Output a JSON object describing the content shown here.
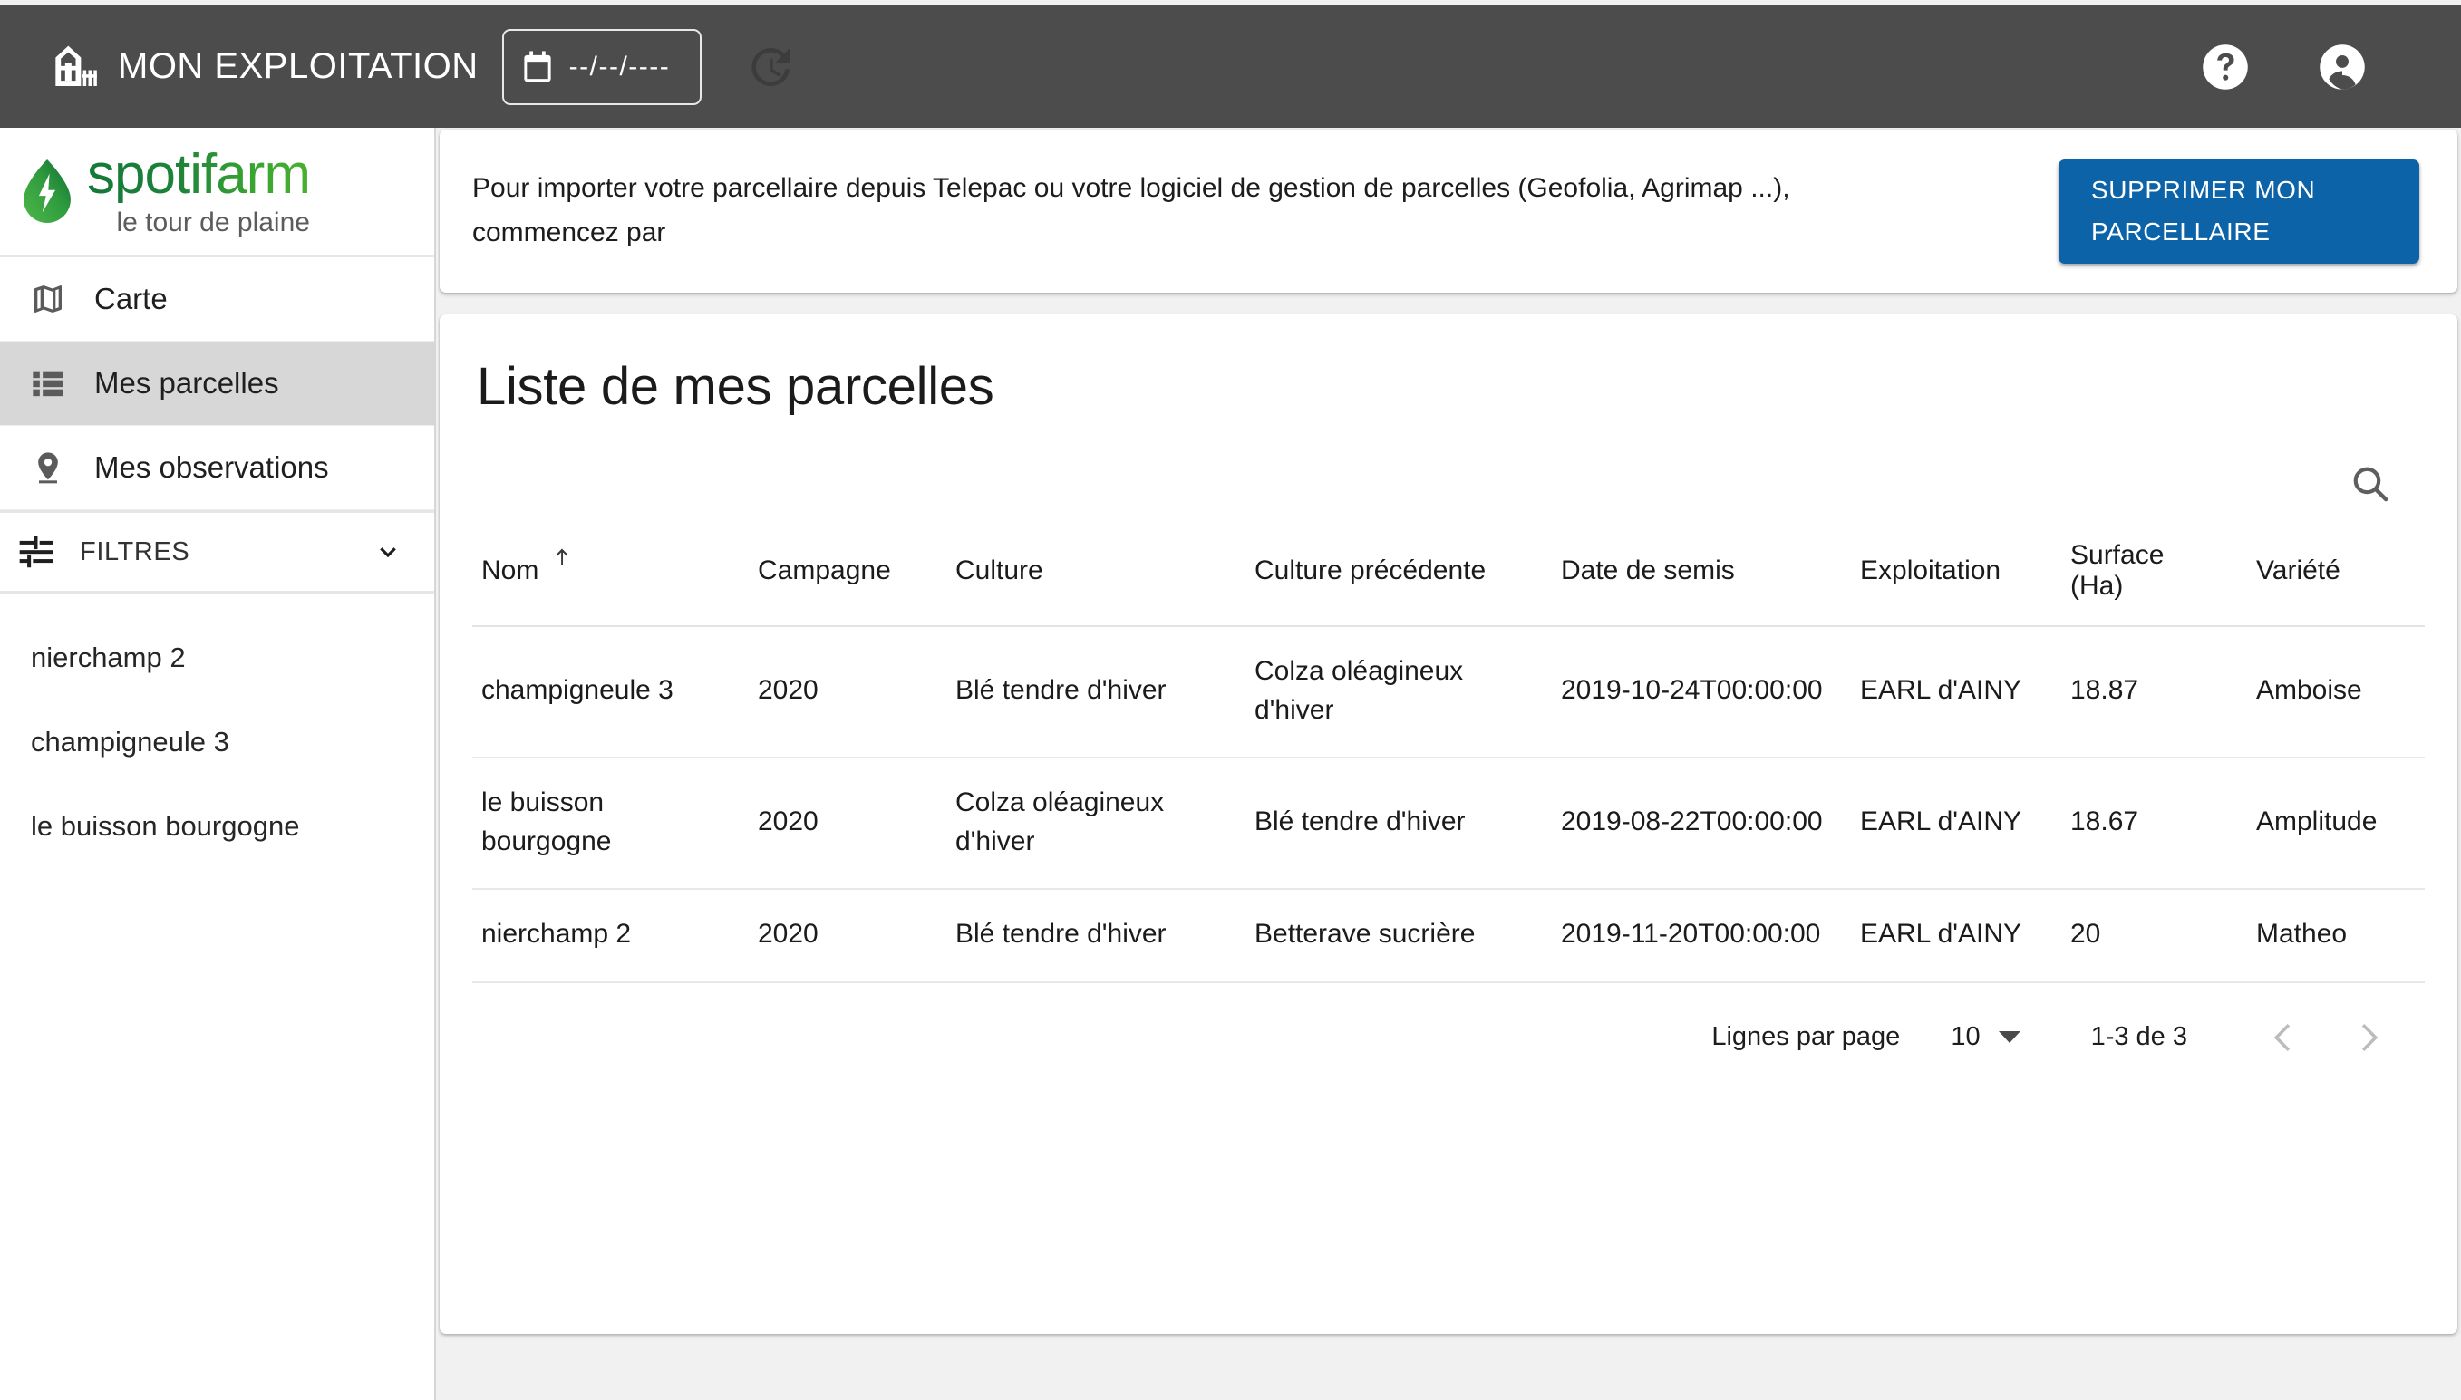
{
  "appbar": {
    "title": "MON EXPLOITATION",
    "date_value": "--/--/----",
    "icons": {
      "barn": "barn-icon",
      "calendar": "calendar-icon",
      "history": "history-icon",
      "help": "help-circle-icon",
      "account": "account-circle-icon"
    }
  },
  "sidebar": {
    "logo": {
      "word": "spotifarm",
      "tagline": "le tour de plaine"
    },
    "nav": [
      {
        "label": "Carte",
        "icon": "map-icon",
        "active": false
      },
      {
        "label": "Mes parcelles",
        "icon": "list-icon",
        "active": true
      },
      {
        "label": "Mes observations",
        "icon": "location-pin-icon",
        "active": false
      }
    ],
    "filters": {
      "label": "FILTRES",
      "icon": "tune-icon",
      "chevron": "chevron-down-icon"
    },
    "parcels": [
      "nierchamp 2",
      "champigneule 3",
      "le buisson bourgogne"
    ]
  },
  "banner": {
    "line1": "Pour importer votre parcellaire depuis Telepac ou votre logiciel de gestion de parcelles (Geofolia, Agrimap ...),",
    "line2": "commencez par",
    "button_line1": "SUPPRIMER MON",
    "button_line2": "PARCELLAIRE",
    "button_color": "#0c63a8"
  },
  "table_panel": {
    "title": "Liste de mes parcelles",
    "search_icon": "search-icon",
    "columns": [
      "Nom",
      "Campagne",
      "Culture",
      "Culture précédente",
      "Date de semis",
      "Exploitation",
      "Surface (Ha)",
      "Variété"
    ],
    "surface_header_line1": "Surface",
    "surface_header_line2": "(Ha)",
    "sort": {
      "column": "Nom",
      "direction": "asc",
      "icon": "arrow-upward-icon"
    },
    "rows": [
      {
        "nom": "champigneule 3",
        "campagne": "2020",
        "culture": "Blé tendre d'hiver",
        "precedente": "Colza oléagineux d'hiver",
        "date_semis": "2019-10-24T00:00:00",
        "exploitation": "EARL d'AINY",
        "surface": "18.87",
        "variete": "Amboise"
      },
      {
        "nom": "le buisson bourgogne",
        "campagne": "2020",
        "culture": "Colza oléagineux d'hiver",
        "precedente": "Blé tendre d'hiver",
        "date_semis": "2019-08-22T00:00:00",
        "exploitation": "EARL d'AINY",
        "surface": "18.67",
        "variete": "Amplitude"
      },
      {
        "nom": "nierchamp 2",
        "campagne": "2020",
        "culture": "Blé tendre d'hiver",
        "precedente": "Betterave sucrière",
        "date_semis": "2019-11-20T00:00:00",
        "exploitation": "EARL d'AINY",
        "surface": "20",
        "variete": "Matheo"
      }
    ],
    "paginator": {
      "rows_per_page_label": "Lignes par page",
      "rows_per_page_value": "10",
      "range_label": "1-3 de 3",
      "prev_icon": "chevron-left-icon",
      "next_icon": "chevron-right-icon"
    }
  }
}
